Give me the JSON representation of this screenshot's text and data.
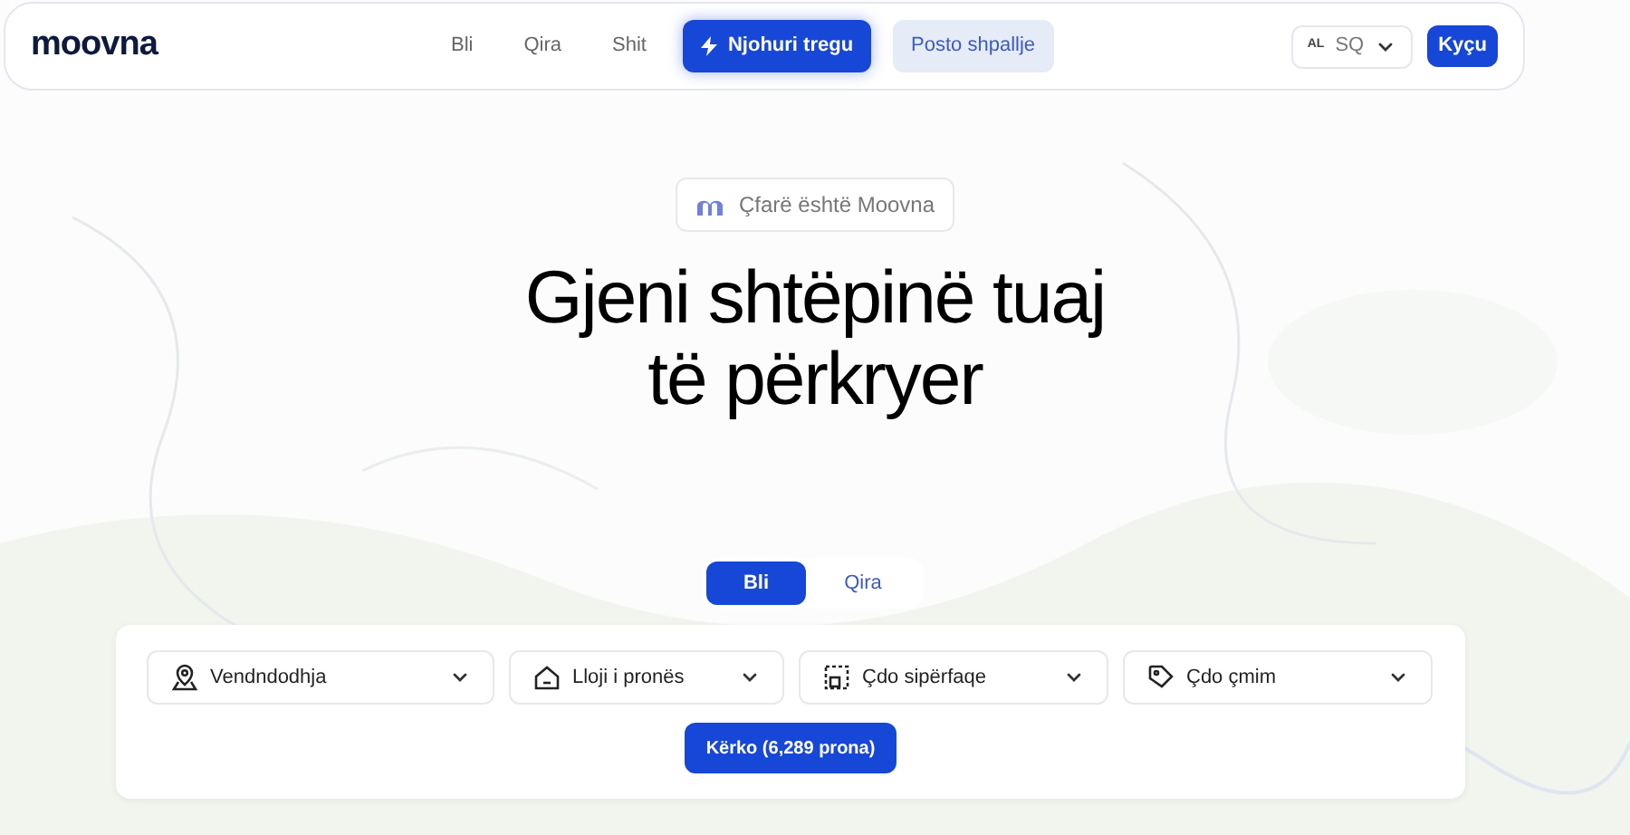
{
  "brand": "moovna",
  "nav": [
    {
      "label": "Bli",
      "kind": "link"
    },
    {
      "label": "Qira",
      "kind": "link"
    },
    {
      "label": "Shit",
      "kind": "link"
    },
    {
      "label": "Njohuri tregu",
      "kind": "primary"
    },
    {
      "label": "Posto shpallje",
      "kind": "secondary"
    }
  ],
  "language": {
    "flag": "AL",
    "code": "SQ"
  },
  "login": "Kyçu",
  "badge": "Çfarë është Moovna",
  "headline": [
    "Gjeni shtëpinë tuaj",
    "të përkryer"
  ],
  "modes": [
    {
      "label": "Bli",
      "selected": true
    },
    {
      "label": "Qira",
      "selected": false
    }
  ],
  "filters": [
    {
      "label": "Vendndodhja"
    },
    {
      "label": "Lloji i pronës"
    },
    {
      "label": "Çdo sipërfaqe"
    },
    {
      "label": "Çdo çmim"
    }
  ],
  "search_button": "Kërko (6,289 prona)"
}
